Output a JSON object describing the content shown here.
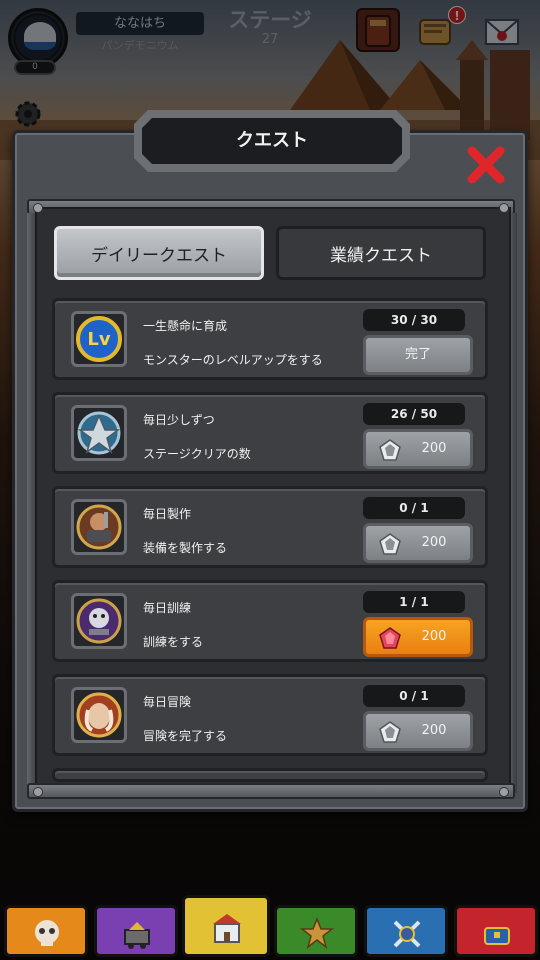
{
  "header": {
    "player_name": "ななはち",
    "player_title": "パンデモニウム",
    "level": "0",
    "stage_label": "ステージ",
    "stage_number": "27",
    "notification_badge": "!"
  },
  "modal": {
    "title": "クエスト",
    "tabs": [
      {
        "label": "デイリークエスト",
        "active": true
      },
      {
        "label": "業績クエスト",
        "active": false
      }
    ]
  },
  "quests": [
    {
      "title": "一生懸命に育成",
      "description": "モンスターのレベルアップをする",
      "progress": "30 / 30",
      "button": "完了",
      "icon": "level-up-icon"
    },
    {
      "title": "毎日少しずつ",
      "description": "ステージクリアの数",
      "progress": "26 / 50",
      "reward": "200",
      "icon": "stage-emblem-icon"
    },
    {
      "title": "毎日製作",
      "description": "装備を製作する",
      "progress": "0 / 1",
      "reward": "200",
      "icon": "craft-icon"
    },
    {
      "title": "毎日訓練",
      "description": "訓練をする",
      "progress": "1 / 1",
      "reward": "200",
      "icon": "training-icon"
    },
    {
      "title": "毎日冒険",
      "description": "冒険を完了する",
      "progress": "0 / 1",
      "reward": "200",
      "icon": "adventure-icon"
    }
  ],
  "bottom_nav": [
    {
      "icon": "skull-icon",
      "color": "#e58a1a"
    },
    {
      "icon": "mine-cart-icon",
      "color": "#7a3fb0"
    },
    {
      "icon": "castle-icon",
      "color": "#e2c234"
    },
    {
      "icon": "star-emblem-icon",
      "color": "#3a8a2a"
    },
    {
      "icon": "crossed-swords-icon",
      "color": "#2b6fb3"
    },
    {
      "icon": "treasure-icon",
      "color": "#c4242b"
    }
  ],
  "colors": {
    "accent_orange": "#f39a1f",
    "close_red": "#e0262b",
    "panel_gray": "#4b4e52"
  }
}
